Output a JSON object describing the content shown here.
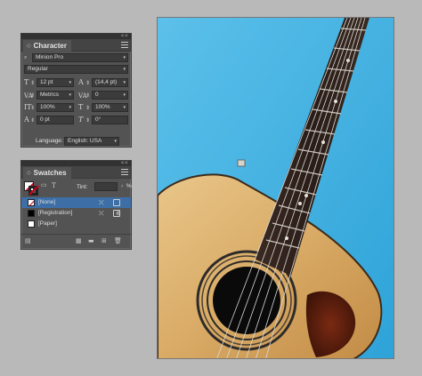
{
  "character_panel": {
    "title": "Character",
    "font_family": "Minion Pro",
    "font_style": "Regular",
    "font_size": "12 pt",
    "leading": "(14,4 pt)",
    "kerning": "Metrics",
    "tracking": "0",
    "vertical_scale": "100%",
    "horizontal_scale": "100%",
    "baseline_shift": "0 pt",
    "skew": "0°",
    "language_label": "Language:",
    "language_value": "English: USA"
  },
  "swatches_panel": {
    "title": "Swatches",
    "tint_label": "Tint:",
    "tint_value": "",
    "tint_unit": "%",
    "items": [
      {
        "name": "[None]",
        "selected": true
      },
      {
        "name": "[Registration]",
        "selected": false
      },
      {
        "name": "[Paper]",
        "selected": false
      }
    ]
  },
  "document": {
    "background_color": "#4fb0e0",
    "subject": "acoustic-guitar"
  },
  "colors": {
    "panel_bg": "#535353",
    "selected_row": "#3d6fa6",
    "canvas_bg": "#b9b9b9"
  }
}
